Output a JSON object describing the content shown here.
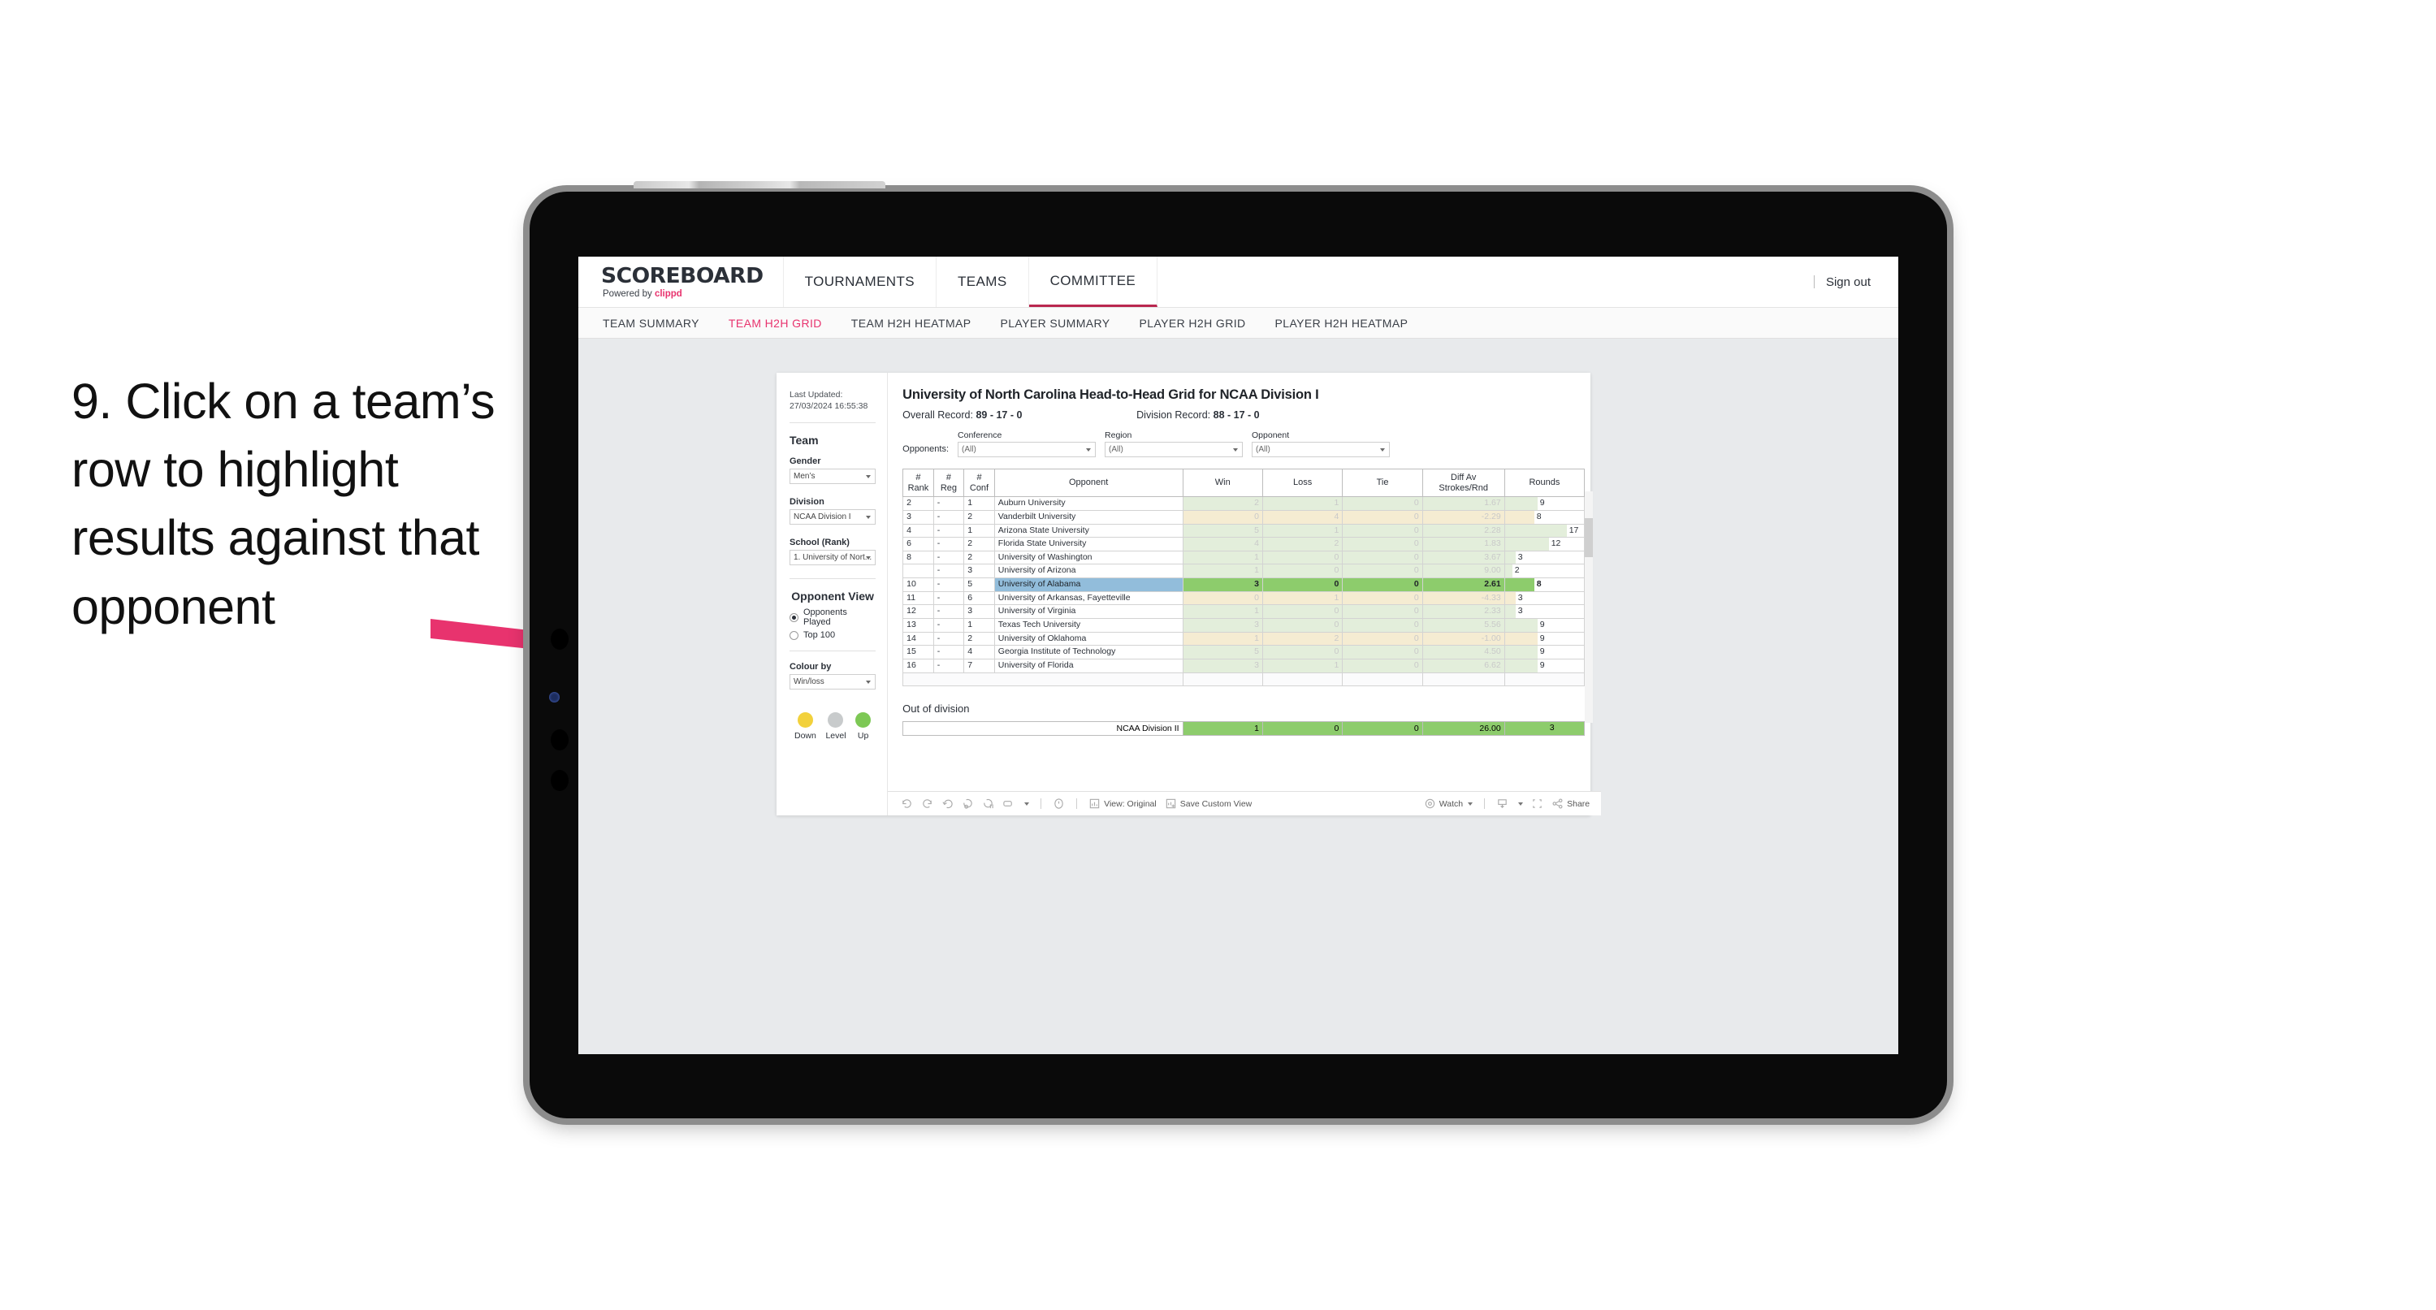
{
  "callout": {
    "text": "9. Click on a team’s row to highlight results against that opponent",
    "arrow_color": "#E8336E"
  },
  "header": {
    "logo_main": "SCOREBOARD",
    "logo_sub_prefix": "Powered by ",
    "logo_brand": "clippd",
    "tabs": [
      {
        "label": "TOURNAMENTS",
        "active": false
      },
      {
        "label": "TEAMS",
        "active": false
      },
      {
        "label": "COMMITTEE",
        "active": true
      }
    ],
    "sign_out": "Sign out"
  },
  "subnav": {
    "items": [
      {
        "label": "TEAM SUMMARY",
        "active": false
      },
      {
        "label": "TEAM H2H GRID",
        "active": true
      },
      {
        "label": "TEAM H2H HEATMAP",
        "active": false
      },
      {
        "label": "PLAYER SUMMARY",
        "active": false
      },
      {
        "label": "PLAYER H2H GRID",
        "active": false
      },
      {
        "label": "PLAYER H2H HEATMAP",
        "active": false
      }
    ]
  },
  "sidebar": {
    "last_updated": "Last Updated: 27/03/2024 16:55:38",
    "team_heading": "Team",
    "gender_label": "Gender",
    "gender_value": "Men’s",
    "division_label": "Division",
    "division_value": "NCAA Division I",
    "school_label": "School (Rank)",
    "school_value": "1. University of Nort...",
    "opponent_view_heading": "Opponent View",
    "opponent_view_options": [
      {
        "label": "Opponents Played",
        "checked": true
      },
      {
        "label": "Top 100",
        "checked": false
      }
    ],
    "colour_by_label": "Colour by",
    "colour_by_value": "Win/loss",
    "legend": [
      {
        "caption": "Down",
        "color": "#F2D13C"
      },
      {
        "caption": "Level",
        "color": "#C8CBCC"
      },
      {
        "caption": "Up",
        "color": "#7DC855"
      }
    ]
  },
  "viz": {
    "title": "University of North Carolina Head-to-Head Grid for NCAA Division I",
    "overall_record_label": "Overall Record: ",
    "overall_record_value": "89 - 17 - 0",
    "division_record_label": "Division Record: ",
    "division_record_value": "88 - 17 - 0",
    "opponents_label": "Opponents:",
    "filters": [
      {
        "label": "Conference",
        "value": "(All)"
      },
      {
        "label": "Region",
        "value": "(All)"
      },
      {
        "label": "Opponent",
        "value": "(All)"
      }
    ],
    "out_of_division_title": "Out of division"
  },
  "chart_data": {
    "type": "table",
    "title": "University of North Carolina Head-to-Head Grid for NCAA Division I",
    "columns": [
      "# Rank",
      "# Reg",
      "# Conf",
      "Opponent",
      "Win",
      "Loss",
      "Tie",
      "Diff Av Strokes/Rnd",
      "Rounds"
    ],
    "column_header_lines": [
      [
        "#",
        "Rank"
      ],
      [
        "#",
        "Reg"
      ],
      [
        "#",
        "Conf"
      ],
      [
        "Opponent"
      ],
      [
        "Win"
      ],
      [
        "Loss"
      ],
      [
        "Tie"
      ],
      [
        "Diff Av",
        "Strokes/Rnd"
      ],
      [
        "Rounds"
      ]
    ],
    "rounds_axis_max": 17,
    "rows": [
      {
        "rank": "2",
        "reg": "-",
        "conf": "1",
        "opponent": "Auburn University",
        "win": "2",
        "loss": "1",
        "tie": "0",
        "diff": "1.67",
        "rounds": 9,
        "tone": "up",
        "highlighted": false
      },
      {
        "rank": "3",
        "reg": "-",
        "conf": "2",
        "opponent": "Vanderbilt University",
        "win": "0",
        "loss": "4",
        "tie": "0",
        "diff": "-2.29",
        "rounds": 8,
        "tone": "down",
        "highlighted": false
      },
      {
        "rank": "4",
        "reg": "-",
        "conf": "1",
        "opponent": "Arizona State University",
        "win": "5",
        "loss": "1",
        "tie": "0",
        "diff": "2.28",
        "rounds": 17,
        "tone": "up",
        "highlighted": false
      },
      {
        "rank": "6",
        "reg": "-",
        "conf": "2",
        "opponent": "Florida State University",
        "win": "4",
        "loss": "2",
        "tie": "0",
        "diff": "1.83",
        "rounds": 12,
        "tone": "up",
        "highlighted": false
      },
      {
        "rank": "8",
        "reg": "-",
        "conf": "2",
        "opponent": "University of Washington",
        "win": "1",
        "loss": "0",
        "tie": "0",
        "diff": "3.67",
        "rounds": 3,
        "tone": "up",
        "highlighted": false
      },
      {
        "rank": "",
        "reg": "-",
        "conf": "3",
        "opponent": "University of Arizona",
        "win": "1",
        "loss": "0",
        "tie": "0",
        "diff": "9.00",
        "rounds": 2,
        "tone": "up",
        "highlighted": false
      },
      {
        "rank": "10",
        "reg": "-",
        "conf": "5",
        "opponent": "University of Alabama",
        "win": "3",
        "loss": "0",
        "tie": "0",
        "diff": "2.61",
        "rounds": 8,
        "tone": "up",
        "highlighted": true
      },
      {
        "rank": "11",
        "reg": "-",
        "conf": "6",
        "opponent": "University of Arkansas, Fayetteville",
        "win": "0",
        "loss": "1",
        "tie": "0",
        "diff": "-4.33",
        "rounds": 3,
        "tone": "down",
        "highlighted": false
      },
      {
        "rank": "12",
        "reg": "-",
        "conf": "3",
        "opponent": "University of Virginia",
        "win": "1",
        "loss": "0",
        "tie": "0",
        "diff": "2.33",
        "rounds": 3,
        "tone": "up",
        "highlighted": false
      },
      {
        "rank": "13",
        "reg": "-",
        "conf": "1",
        "opponent": "Texas Tech University",
        "win": "3",
        "loss": "0",
        "tie": "0",
        "diff": "5.56",
        "rounds": 9,
        "tone": "up",
        "highlighted": false
      },
      {
        "rank": "14",
        "reg": "-",
        "conf": "2",
        "opponent": "University of Oklahoma",
        "win": "1",
        "loss": "2",
        "tie": "0",
        "diff": "-1.00",
        "rounds": 9,
        "tone": "down",
        "highlighted": false
      },
      {
        "rank": "15",
        "reg": "-",
        "conf": "4",
        "opponent": "Georgia Institute of Technology",
        "win": "5",
        "loss": "0",
        "tie": "0",
        "diff": "4.50",
        "rounds": 9,
        "tone": "up",
        "highlighted": false
      },
      {
        "rank": "16",
        "reg": "-",
        "conf": "7",
        "opponent": "University of Florida",
        "win": "3",
        "loss": "1",
        "tie": "0",
        "diff": "6.62",
        "rounds": 9,
        "tone": "up",
        "highlighted": false
      }
    ],
    "out_of_division": [
      {
        "name": "NCAA Division II",
        "win": "1",
        "loss": "0",
        "tie": "0",
        "diff": "26.00",
        "rounds": "3"
      }
    ],
    "colors": {
      "tone_up": "#e3eedb",
      "tone_down": "#f5ecd2",
      "highlight_green": "#8dcc6c",
      "highlight_blue": "#92bddb"
    }
  },
  "toolbar": {
    "view_label": "View: Original",
    "save_label": "Save Custom View",
    "watch_label": "Watch",
    "share_label": "Share"
  }
}
